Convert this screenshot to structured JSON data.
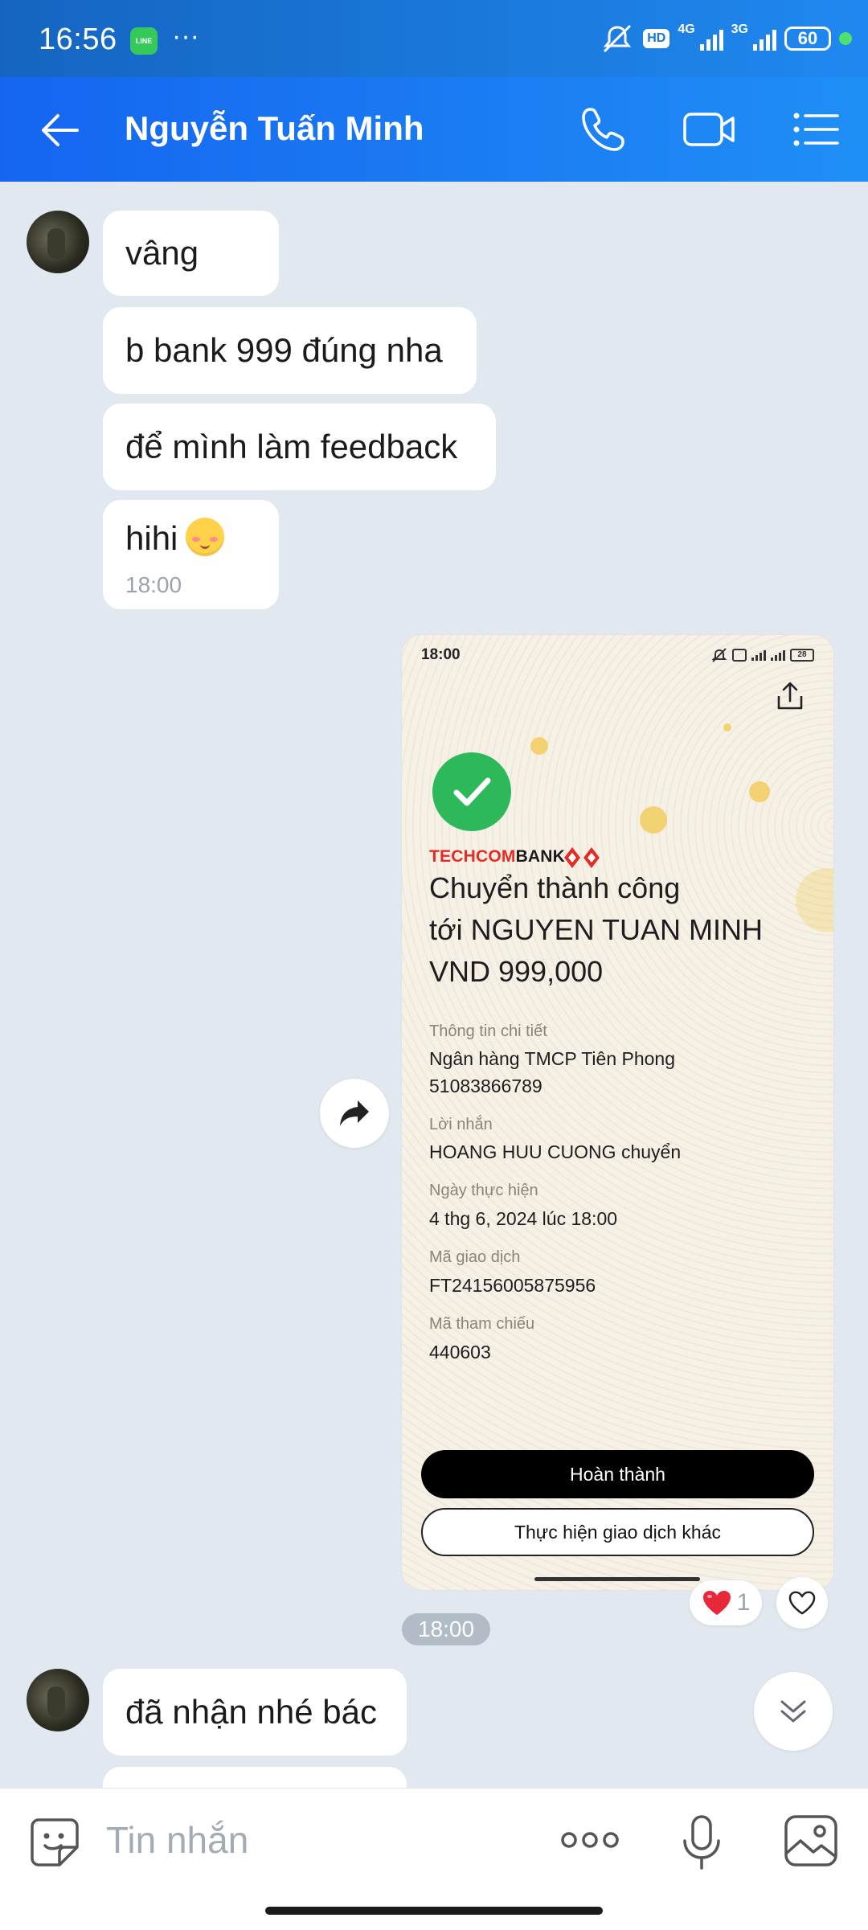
{
  "status_bar": {
    "time": "16:56",
    "app_badge": "LINE",
    "more": "···",
    "net1": "4G",
    "net2": "3G",
    "hd": "HD",
    "battery": "60"
  },
  "header": {
    "contact_name": "Nguyễn Tuấn Minh"
  },
  "messages": [
    {
      "text": "vâng"
    },
    {
      "text": "b bank 999 đúng nha"
    },
    {
      "text": "để mình làm feedback"
    },
    {
      "text": "hihi",
      "emoji": "☺",
      "time": "18:00"
    },
    {
      "text": "đã nhận nhé bác"
    }
  ],
  "receipt": {
    "status_time": "18:00",
    "battery": "28",
    "bank_brand": "TECHCOM",
    "bank_brand_bold": "BANK",
    "headline1": "Chuyển thành công",
    "headline2": "tới NGUYEN TUAN MINH",
    "headline3": "VND 999,000",
    "detail_label": "Thông tin chi tiết",
    "bank_name": "Ngân hàng TMCP Tiên Phong",
    "account": "51083866789",
    "msg_label": "Lời nhắn",
    "msg_value": "HOANG HUU CUONG chuyển",
    "date_label": "Ngày thực hiện",
    "date_value": "4 thg 6, 2024 lúc 18:00",
    "txn_label": "Mã giao dịch",
    "txn_value": "FT24156005875956",
    "ref_label": "Mã tham chiếu",
    "ref_value": "440603",
    "btn_done": "Hoàn thành",
    "btn_other": "Thực hiện giao dịch khác"
  },
  "reaction": {
    "emoji": "❤️",
    "count": "1"
  },
  "image_time": "18:00",
  "composer": {
    "placeholder": "Tin nhắn"
  },
  "colors": {
    "header": "#1f86f2",
    "chat_bg": "#e2e8f0",
    "success": "#2db85a",
    "techcom_red": "#e52b24"
  }
}
